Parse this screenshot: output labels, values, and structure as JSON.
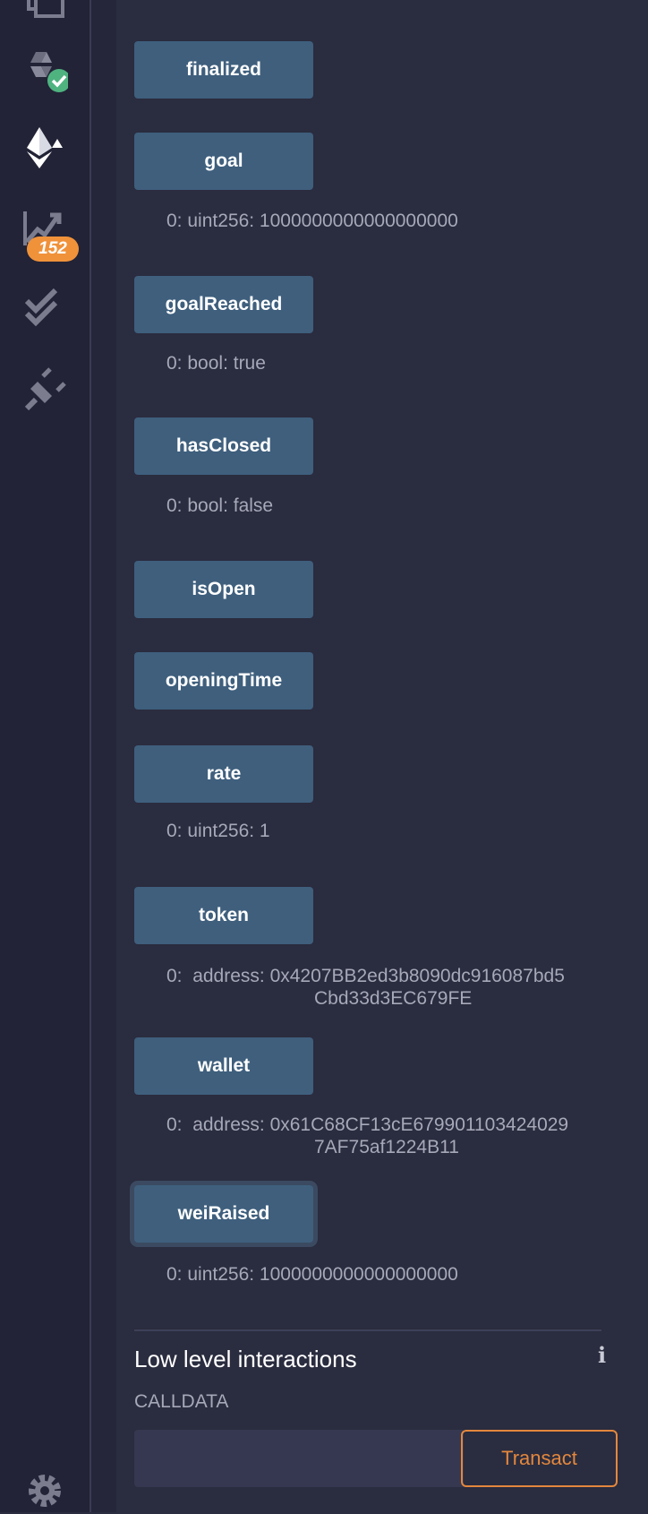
{
  "sidebar": {
    "badge_count": "152",
    "icons": [
      "file-explorer-icon",
      "solidity-compiler-icon",
      "deploy-run-icon",
      "analysis-icon",
      "testing-icon",
      "plugin-manager-icon",
      "settings-icon"
    ],
    "accent_check": "#4fb380",
    "accent_badge": "#f0923a"
  },
  "functions": [
    {
      "label": "finalized"
    },
    {
      "label": "goal",
      "result_idx": "0:",
      "result": "uint256: 1000000000000000000"
    },
    {
      "label": "goalReached",
      "result_idx": "0:",
      "result": "bool: true"
    },
    {
      "label": "hasClosed",
      "result_idx": "0:",
      "result": "bool: false"
    },
    {
      "label": "isOpen"
    },
    {
      "label": "openingTime"
    },
    {
      "label": "rate",
      "result_idx": "0:",
      "result": "uint256: 1"
    },
    {
      "label": "token",
      "result_idx": "0:",
      "result_l1": "address: 0x4207BB2ed3b8090dc916087bd5",
      "result_l2": "Cbd33d3EC679FE"
    },
    {
      "label": "wallet",
      "result_idx": "0:",
      "result_l1": "address: 0x61C68CF13cE679901103424029",
      "result_l2": "7AF75af1224B11"
    },
    {
      "label": "weiRaised",
      "result_idx": "0:",
      "result": "uint256: 1000000000000000000"
    }
  ],
  "low_level": {
    "title": "Low level interactions",
    "calldata_label": "CALLDATA",
    "calldata_value": "",
    "transact_label": "Transact"
  },
  "colors": {
    "button_bg": "#3f5f7d",
    "panel_bg": "#2a2c3f",
    "transact": "#e3873d"
  }
}
